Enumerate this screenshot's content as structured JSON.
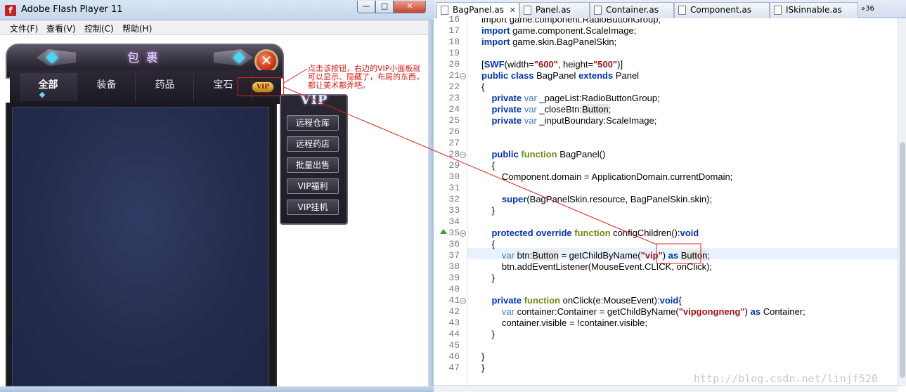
{
  "flash_window": {
    "title": "Adobe Flash Player 11",
    "app_icon_glyph": "f",
    "buttons": {
      "minimize": "—",
      "maximize": "□",
      "close": "✕"
    },
    "menu": [
      "文件(F)",
      "查看(V)",
      "控制(C)",
      "帮助(H)"
    ]
  },
  "bag_panel": {
    "title": "包裹",
    "close_glyph": "✕",
    "tabs": [
      "全部",
      "装备",
      "药品",
      "宝石"
    ],
    "active_tab": "全部",
    "vip_button": "VIP"
  },
  "vip_panel": {
    "title": "VIP",
    "buttons": [
      "远程仓库",
      "远程药店",
      "批量出售",
      "VIP福利",
      "VIP挂机"
    ]
  },
  "annotation": {
    "text": "点击该按钮，右边的VIP小面板就可以显示、隐藏了，布局的东西，都让美术都弄吧。",
    "color": "#d81c14"
  },
  "editor": {
    "tabs": [
      {
        "label": "BagPanel.as",
        "active": true,
        "close": "✕"
      },
      {
        "label": "Panel.as",
        "active": false
      },
      {
        "label": "Container.as",
        "active": false
      },
      {
        "label": "Component.as",
        "active": false
      },
      {
        "label": "ISkinnable.as",
        "active": false
      }
    ],
    "tab_overflow": "»36",
    "lines": [
      {
        "no": "16",
        "html": "import game.component.RadioButtonGroup;"
      },
      {
        "no": "17",
        "html": "<span class=\"kw\">import</span> game.component.ScaleImage;"
      },
      {
        "no": "18",
        "html": "<span class=\"kw\">import</span> game.skin.BagPanelSkin;"
      },
      {
        "no": "19",
        "html": ""
      },
      {
        "no": "20",
        "html": "[<span class=\"kw\">SWF</span>(width=<span class=\"str\">\"600\"</span>, height=<span class=\"str\">\"500\"</span>)]"
      },
      {
        "no": "21",
        "html": "<span class=\"kw\">public</span> <span class=\"kw\">class</span> BagPanel <span class=\"kw\">extends</span> Panel"
      },
      {
        "no": "22",
        "html": "{"
      },
      {
        "no": "23",
        "html": "    <span class=\"kw\">private</span> <span class=\"kw3\">var</span> _pageList:RadioButtonGroup;"
      },
      {
        "no": "24",
        "html": "    <span class=\"kw\">private</span> <span class=\"kw3\">var</span> _closeBtn:<span class=\"hl\">Button</span>;"
      },
      {
        "no": "25",
        "html": "    <span class=\"kw\">private</span> <span class=\"kw3\">var</span> _inputBoundary:ScaleImage;"
      },
      {
        "no": "26",
        "html": ""
      },
      {
        "no": "27",
        "html": ""
      },
      {
        "no": "28",
        "html": "    <span class=\"kw\">public</span> <span class=\"kw2\">function</span> BagPanel()"
      },
      {
        "no": "29",
        "html": "    {"
      },
      {
        "no": "30",
        "html": "        Component.domain = ApplicationDomain.currentDomain;"
      },
      {
        "no": "31",
        "html": ""
      },
      {
        "no": "32",
        "html": "        <span class=\"kw\">super</span>(BagPanelSkin.resource, BagPanelSkin.skin);"
      },
      {
        "no": "33",
        "html": "    }"
      },
      {
        "no": "34",
        "html": ""
      },
      {
        "no": "35",
        "html": "    <span class=\"kw\">protected</span> <span class=\"kw\">override</span> <span class=\"kw2\">function</span> configChildren():<span class=\"kw\">void</span>"
      },
      {
        "no": "36",
        "html": "    {"
      },
      {
        "no": "37",
        "html": "        <span class=\"kw3\">var</span> btn:<span class=\"hl\">Button</span> = getChildByName(<span class=\"str\">\"vip\"</span>) <span class=\"kw\">as</span> <span class=\"hl\">Button</span>;"
      },
      {
        "no": "38",
        "html": "        btn.addEventListener(MouseEvent.CLICK, onClick);"
      },
      {
        "no": "39",
        "html": "    }"
      },
      {
        "no": "40",
        "html": ""
      },
      {
        "no": "41",
        "html": "    <span class=\"kw\">private</span> <span class=\"kw2\">function</span> onClick(e:MouseEvent):<span class=\"kw\">void</span>{"
      },
      {
        "no": "42",
        "html": "        <span class=\"kw3\">var</span> container:Container = getChildByName(<span class=\"str\">\"vipgongneng\"</span>) <span class=\"kw\">as</span> Container;"
      },
      {
        "no": "43",
        "html": "        container.visible = !container.visible;"
      },
      {
        "no": "44",
        "html": "    }"
      },
      {
        "no": "45",
        "html": ""
      },
      {
        "no": "46",
        "html": "}"
      },
      {
        "no": "47",
        "html": "}"
      }
    ],
    "watermark": "http://blog.csdn.net/linjf520"
  }
}
